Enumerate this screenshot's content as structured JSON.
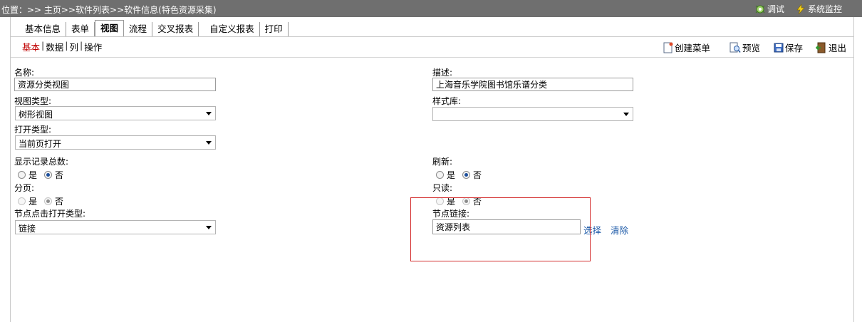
{
  "breadcrumb": "位置：>> 主页>>软件列表>>软件信息(特色资源采集)",
  "top_tools": {
    "debug": "调试",
    "monitor": "系统监控"
  },
  "tabs": [
    "基本信息",
    "表单",
    "视图",
    "流程",
    "交叉报表",
    "自定义报表",
    "打印"
  ],
  "active_tab": "视图",
  "subnav": {
    "basic": "基本",
    "data": "数据",
    "column": "列",
    "operation": "操作",
    "sep": "|"
  },
  "actions": {
    "create_menu": "创建菜单",
    "preview": "预览",
    "save": "保存",
    "exit": "退出"
  },
  "form": {
    "name": {
      "label": "名称:",
      "value": "资源分类视图"
    },
    "description": {
      "label": "描述:",
      "value": "上海音乐学院图书馆乐谱分类"
    },
    "view_type": {
      "label": "视图类型:",
      "value": "树形视图"
    },
    "style_lib": {
      "label": "样式库:",
      "value": ""
    },
    "open_type": {
      "label": "打开类型:",
      "value": "当前页打开"
    },
    "show_total": {
      "label": "显示记录总数:",
      "yes": "是",
      "no": "否",
      "selected": "否"
    },
    "refresh": {
      "label": "刷新:",
      "yes": "是",
      "no": "否",
      "selected": "否"
    },
    "paging": {
      "label": "分页:",
      "yes": "是",
      "no": "否",
      "selected": "否",
      "disabled": true
    },
    "readonly": {
      "label": "只读:",
      "yes": "是",
      "no": "否",
      "selected": "否",
      "disabled": true
    },
    "node_click_open_type": {
      "label": "节点点击打开类型:",
      "value": "链接"
    },
    "node_link": {
      "label": "节点链接:",
      "value": "资源列表",
      "select": "选择",
      "clear": "清除"
    }
  },
  "colors": {
    "topbar": "#6f6f6f",
    "active_subnav": "#c00000",
    "link": "#1d5aa8",
    "highlight_box": "#d43030"
  }
}
